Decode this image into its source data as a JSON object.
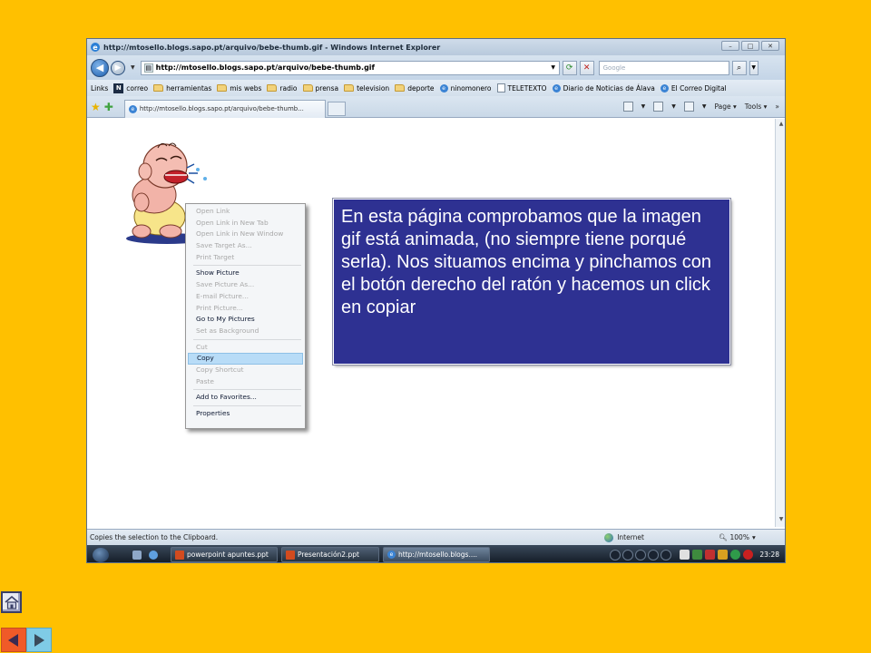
{
  "browser": {
    "window_title": "http://mtosello.blogs.sapo.pt/arquivo/bebe-thumb.gif - Windows Internet Explorer",
    "address": "http://mtosello.blogs.sapo.pt/arquivo/bebe-thumb.gif",
    "search_placeholder": "Google",
    "links_label": "Links",
    "links": [
      "correo",
      "herramientas",
      "mis webs",
      "radio",
      "prensa",
      "television",
      "deporte",
      "ninomonero",
      "TELETEXTO",
      "Diario de Noticias de Álava",
      "El Correo Digital"
    ],
    "tab_title": "http://mtosello.blogs.sapo.pt/arquivo/bebe-thumb...",
    "page_menu": "Page",
    "tools_menu": "Tools"
  },
  "context_menu": {
    "groups": [
      [
        {
          "label": "Open Link",
          "enabled": false
        },
        {
          "label": "Open Link in New Tab",
          "enabled": false
        },
        {
          "label": "Open Link in New Window",
          "enabled": false
        },
        {
          "label": "Save Target As...",
          "enabled": false
        },
        {
          "label": "Print Target",
          "enabled": false
        }
      ],
      [
        {
          "label": "Show Picture",
          "enabled": true
        },
        {
          "label": "Save Picture As...",
          "enabled": false
        },
        {
          "label": "E-mail Picture...",
          "enabled": false
        },
        {
          "label": "Print Picture...",
          "enabled": false
        },
        {
          "label": "Go to My Pictures",
          "enabled": true
        },
        {
          "label": "Set as Background",
          "enabled": false
        }
      ],
      [
        {
          "label": "Cut",
          "enabled": false
        },
        {
          "label": "Copy",
          "enabled": true,
          "selected": true
        },
        {
          "label": "Copy Shortcut",
          "enabled": false
        },
        {
          "label": "Paste",
          "enabled": false
        }
      ],
      [
        {
          "label": "Add to Favorites...",
          "enabled": true
        }
      ],
      [
        {
          "label": "Properties",
          "enabled": true
        }
      ]
    ]
  },
  "status": {
    "text": "Copies the selection to the Clipboard.",
    "zone": "Internet",
    "zoom": "100%"
  },
  "taskbar": {
    "items": [
      "powerpoint apuntes.ppt",
      "Presentación2.ppt",
      "http://mtosello.blogs...."
    ],
    "clock": "23:28"
  },
  "callout": {
    "text": "En esta página comprobamos que la imagen gif está animada, (no siempre tiene porqué serla). Nos situamos encima y pinchamos con el botón derecho del ratón y hacemos un click en copiar"
  },
  "colors": {
    "slide_background": "#FFC000",
    "callout_background": "#2E3192",
    "menu_highlight": "#B8DCF7",
    "prev_button": "#F05A28",
    "next_button": "#7FCBE6"
  },
  "icons": {
    "home": "house-icon",
    "prev": "triangle-left-icon",
    "next": "triangle-right-icon"
  }
}
